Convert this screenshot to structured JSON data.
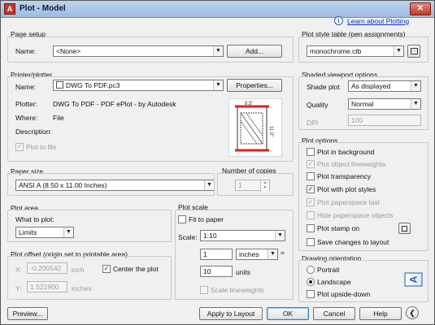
{
  "window": {
    "title": "Plot - Model",
    "app_icon": "autocad-icon",
    "close_label": "✕"
  },
  "help_link": {
    "label": "Learn about Plotting",
    "icon": "info-icon"
  },
  "page_setup": {
    "title": "Page setup",
    "name_label": "Name:",
    "name_value": "<None>",
    "add_button": "Add..."
  },
  "printer": {
    "title": "Printer/plotter",
    "name_label": "Name:",
    "name_value": "DWG To PDF.pc3",
    "properties_button": "Properties...",
    "plotter_label": "Plotter:",
    "plotter_value": "DWG To PDF - PDF ePlot - by Autodesk",
    "where_label": "Where:",
    "where_value": "File",
    "description_label": "Description:",
    "plot_to_file": "Plot to file",
    "preview_width": "8.5\"",
    "preview_height": "11.0\""
  },
  "paper_size": {
    "title": "Paper size",
    "value": "ANSI A (8.50 x 11.00 Inches)"
  },
  "copies": {
    "title": "Number of copies",
    "value": "1"
  },
  "plot_area": {
    "title": "Plot area",
    "what_label": "What to plot:",
    "what_value": "Limits"
  },
  "plot_offset": {
    "title": "Plot offset (origin set to printable area)",
    "x_label": "X:",
    "x_value": "-0.200542",
    "x_unit": "inch",
    "y_label": "Y:",
    "y_value": "1.521900",
    "y_unit": "inches",
    "center": "Center the plot"
  },
  "plot_scale": {
    "title": "Plot scale",
    "fit": "Fit to paper",
    "scale_label": "Scale:",
    "scale_value": "1:10",
    "v1": "1",
    "unit1": "inches",
    "eq": "=",
    "v2": "10",
    "unit2": "units",
    "lineweights": "Scale lineweights"
  },
  "style_table": {
    "title": "Plot style table (pen assignments)",
    "value": "monochrome.ctb"
  },
  "shaded": {
    "title": "Shaded viewport options",
    "shade_label": "Shade plot",
    "shade_value": "As displayed",
    "quality_label": "Quality",
    "quality_value": "Normal",
    "dpi_label": "DPI",
    "dpi_value": "100"
  },
  "plot_options": {
    "title": "Plot options",
    "items": [
      {
        "label": "Plot in background",
        "checked": false,
        "disabled": false
      },
      {
        "label": "Plot object lineweights",
        "checked": true,
        "disabled": true
      },
      {
        "label": "Plot transparency",
        "checked": false,
        "disabled": false
      },
      {
        "label": "Plot with plot styles",
        "checked": true,
        "disabled": false
      },
      {
        "label": "Plot paperspace last",
        "checked": true,
        "disabled": true
      },
      {
        "label": "Hide paperspace objects",
        "checked": false,
        "disabled": true
      },
      {
        "label": "Plot stamp on",
        "checked": false,
        "disabled": false
      },
      {
        "label": "Save changes to layout",
        "checked": false,
        "disabled": false
      }
    ]
  },
  "orientation": {
    "title": "Drawing orientation",
    "portrait": "Portrait",
    "landscape": "Landscape",
    "upside": "Plot upside-down",
    "selected": "Landscape",
    "preview_letter": "A"
  },
  "footer": {
    "preview": "Preview...",
    "apply": "Apply to Layout",
    "ok": "OK",
    "cancel": "Cancel",
    "help": "Help"
  },
  "colors": {
    "title_bar": "#a9c4e6",
    "close": "#c0392b",
    "link": "#0033cc",
    "paper_edge": "#e02020"
  }
}
